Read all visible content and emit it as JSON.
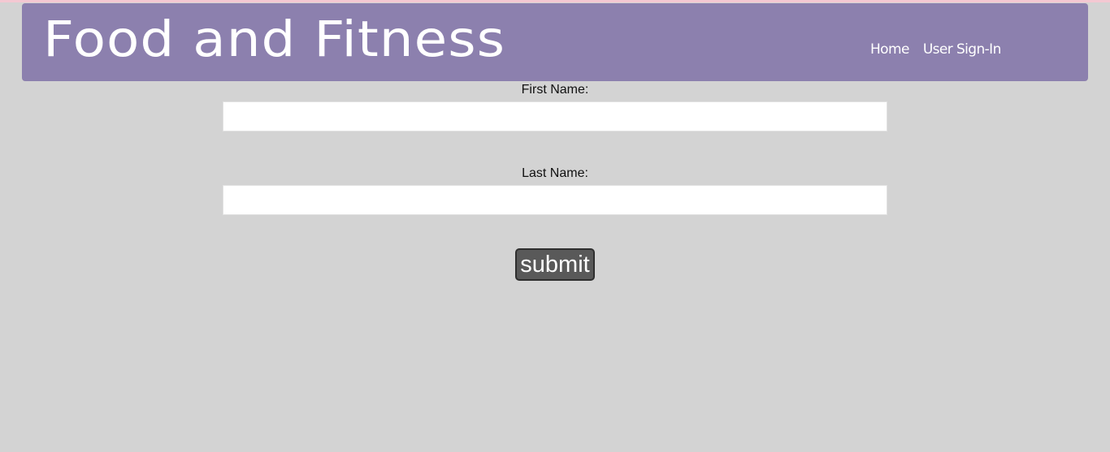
{
  "header": {
    "title": "Food and Fitness",
    "nav": {
      "home": "Home",
      "sign_in": "User Sign-In"
    }
  },
  "form": {
    "first_name": {
      "label": "First Name:",
      "value": ""
    },
    "last_name": {
      "label": "Last Name:",
      "value": ""
    },
    "submit_label": "submit"
  },
  "colors": {
    "page_background": "#d3d3d3",
    "header_background": "#8c80ae",
    "top_strip": "#f4c8d2",
    "button_background": "#595959"
  }
}
